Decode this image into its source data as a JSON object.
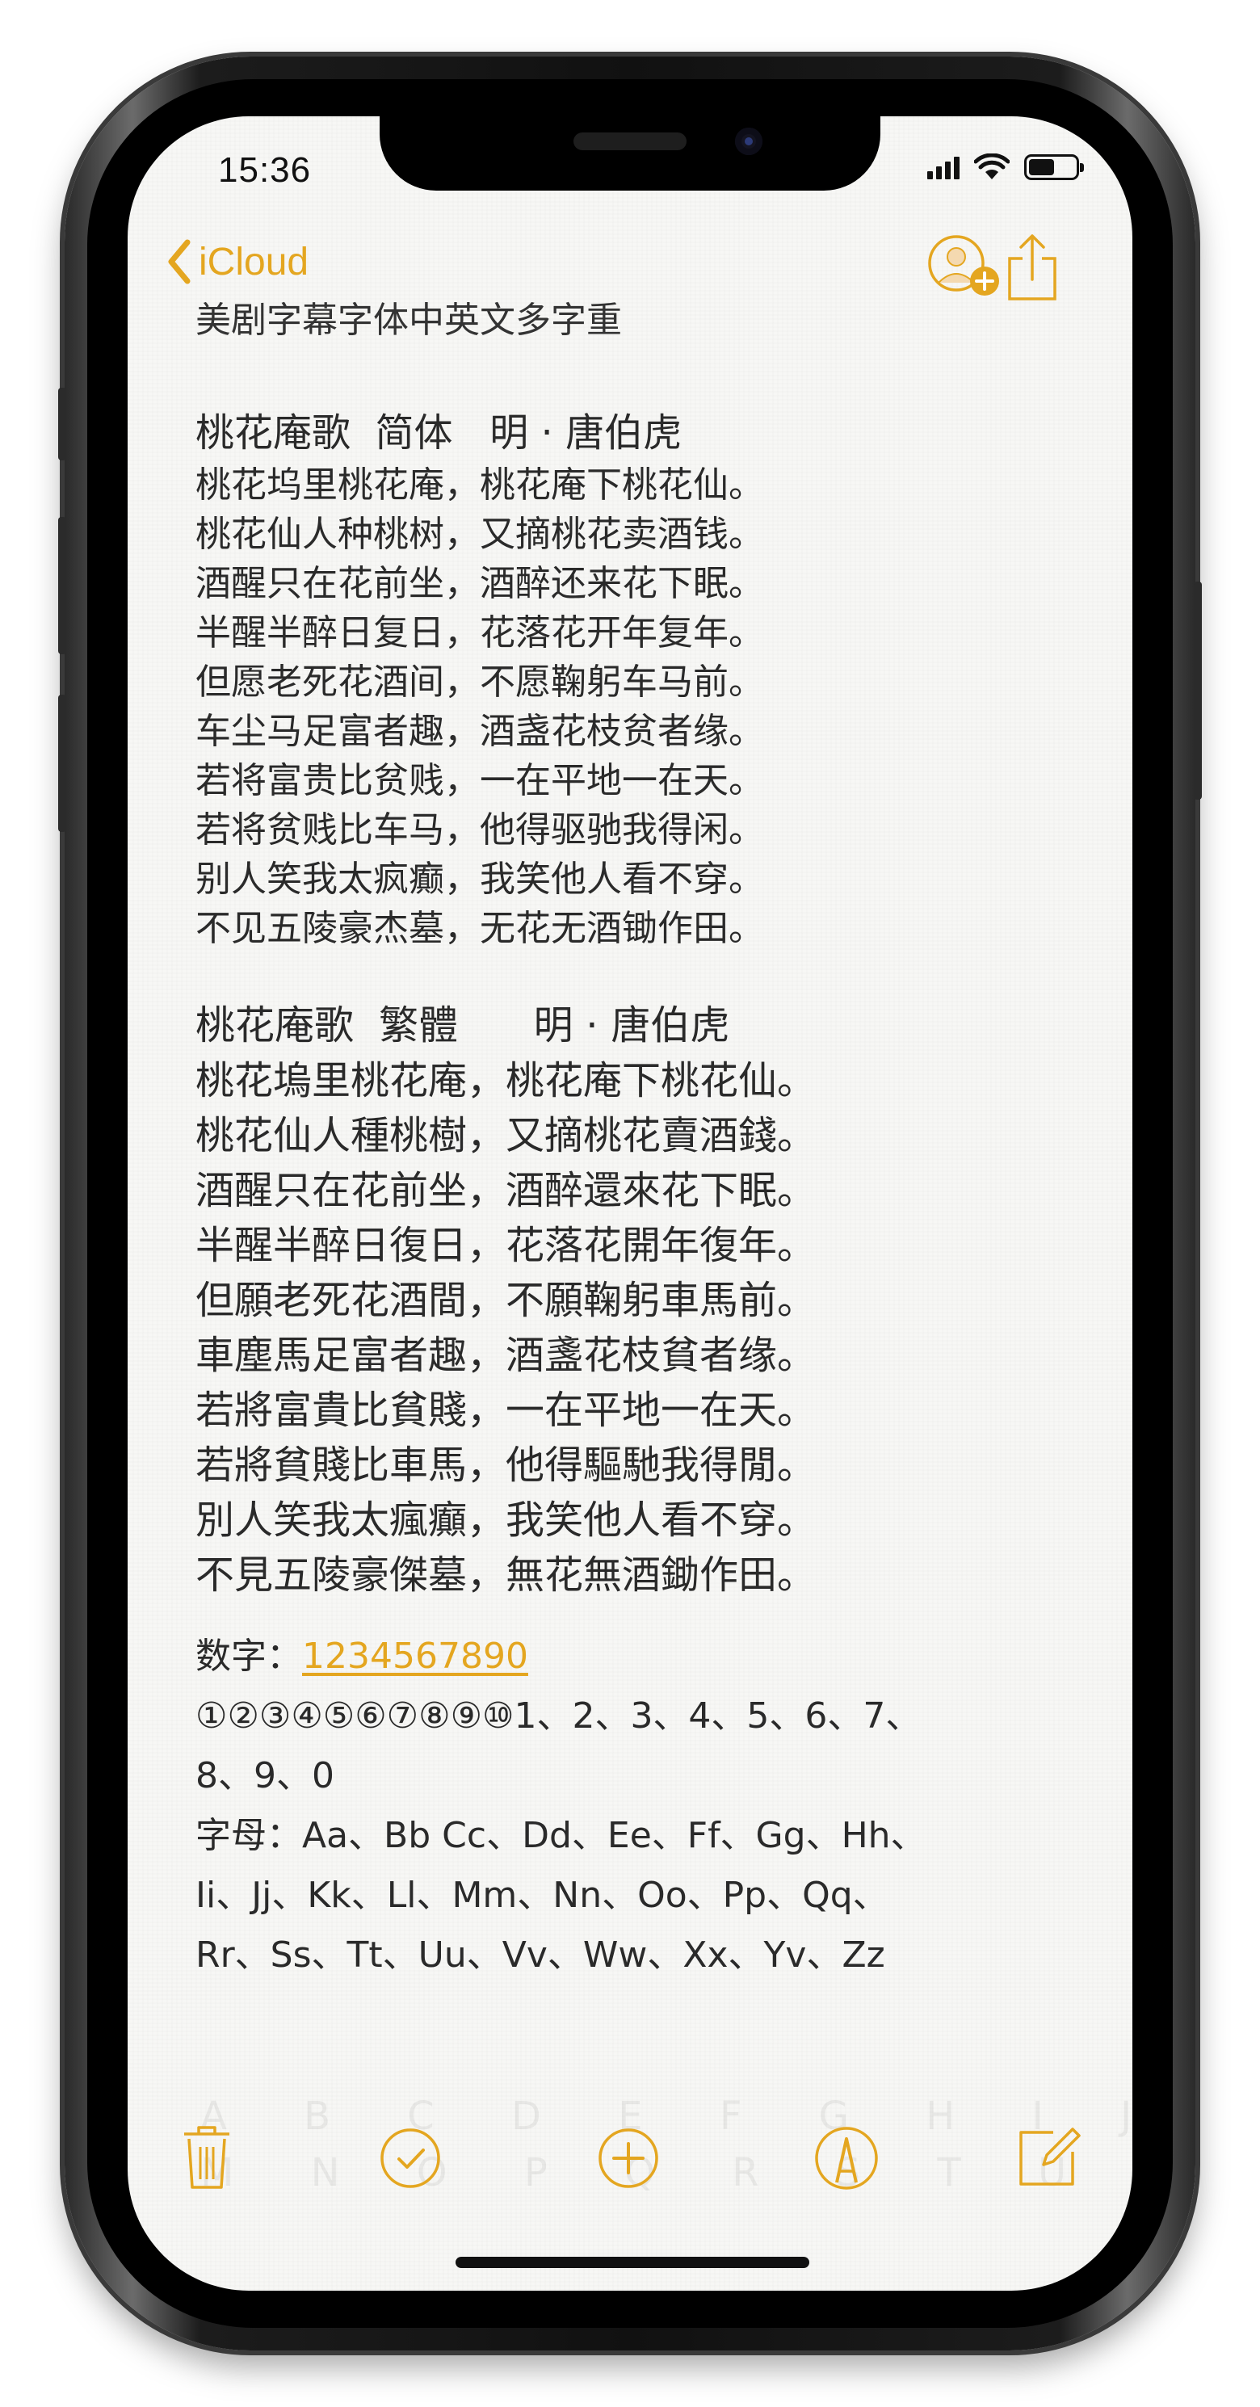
{
  "status_bar": {
    "time": "15:36",
    "battery_level": 0.55
  },
  "navbar": {
    "back_label": "iCloud",
    "icons": [
      "add-person-icon",
      "share-icon"
    ]
  },
  "note": {
    "title": "美剧字幕字体中英文多字重",
    "poem_simplified": {
      "heading": "桃花庵歌  简体   明 · 唐伯虎",
      "lines": [
        "桃花坞里桃花庵，桃花庵下桃花仙。",
        "桃花仙人种桃树，又摘桃花卖酒钱。",
        "酒醒只在花前坐，酒醉还来花下眠。",
        "半醒半醉日复日，花落花开年复年。",
        "但愿老死花酒间，不愿鞠躬车马前。",
        "车尘马足富者趣，酒盏花枝贫者缘。",
        "若将富贵比贫贱，一在平地一在天。",
        "若将贫贱比车马，他得驱驰我得闲。",
        "别人笑我太疯癫，我笑他人看不穿。",
        "不见五陵豪杰墓，无花无酒锄作田。"
      ]
    },
    "poem_traditional": {
      "heading": "桃花庵歌  繁體      明 · 唐伯虎",
      "lines": [
        "桃花塢里桃花庵，桃花庵下桃花仙。",
        "桃花仙人種桃樹，又摘桃花賣酒錢。",
        "酒醒只在花前坐，酒醉還來花下眠。",
        "半醒半醉日復日，花落花開年復年。",
        "但願老死花酒間，不願鞠躬車馬前。",
        "車塵馬足富者趣，酒盞花枝貧者缘。",
        "若將富貴比貧賤，一在平地一在天。",
        "若將貧賤比車馬，他得驅馳我得閒。",
        "別人笑我太瘋癲，我笑他人看不穿。",
        "不見五陵豪傑墓，無花無酒鋤作田。"
      ]
    },
    "numbers_label": "数字：",
    "numbers_link": "1234567890",
    "numbers_line2": "①②③④⑤⑥⑦⑧⑨⑩1、2、3、4、5、6、7、",
    "numbers_line3": "8、9、0",
    "letters_line1": "字母：Aa、Bb Cc、Dd、Ee、Ff、Gg、Hh、",
    "letters_line2": "Ii、Jj、Kk、Ll、Mm、Nn、Oo、Pp、Qq、",
    "letters_line3": "Rr、Ss、Tt、Uu、Vv、Ww、Xx、Yv、Zz",
    "ghost_line1": "A B C D E F G H I J K L",
    "ghost_line2": "M N O P Q R S T U V W X"
  },
  "toolbar": {
    "icons": [
      "trash-icon",
      "checklist-icon",
      "add-icon",
      "markup-icon",
      "compose-icon"
    ]
  },
  "colors": {
    "accent": "#e4a620",
    "text": "#2a2a2a",
    "paper": "#f7f7f5"
  }
}
